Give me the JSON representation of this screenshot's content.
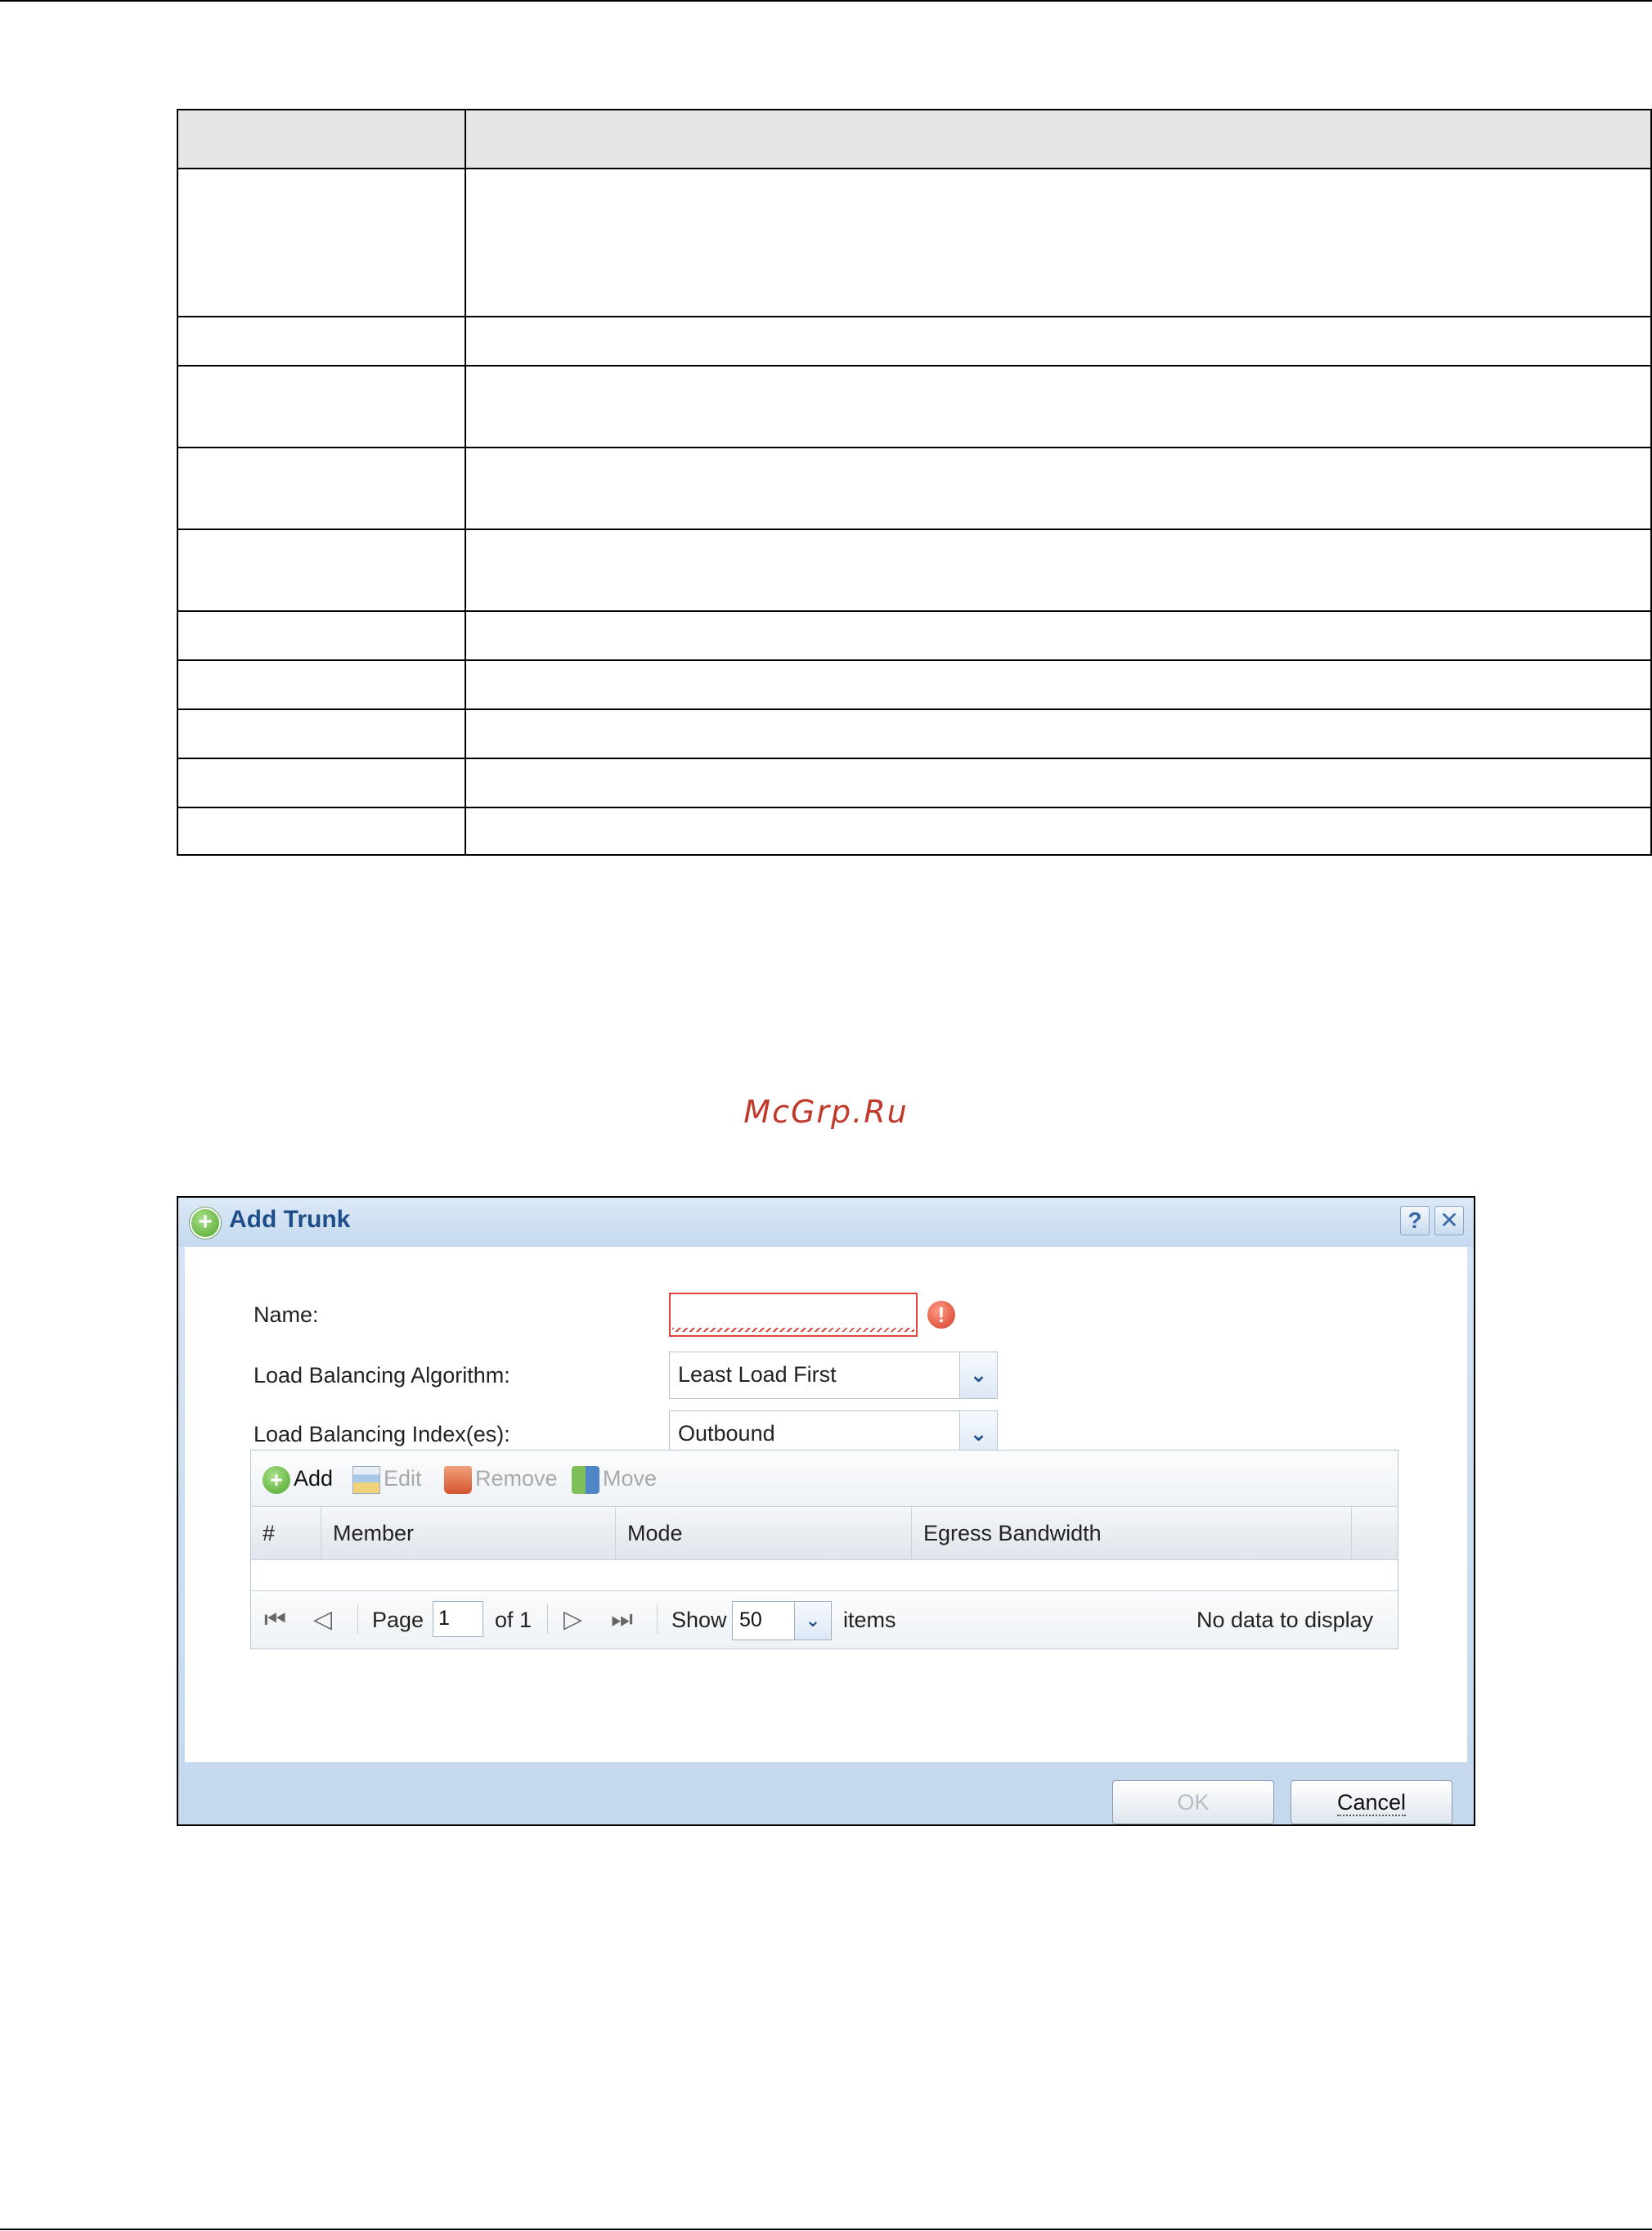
{
  "dialog": {
    "title": "Add Trunk",
    "help_glyph": "?",
    "close_glyph": "✕",
    "fields": {
      "name_label": "Name:",
      "name_value": "",
      "algorithm_label": "Load Balancing Algorithm:",
      "algorithm_value": "Least Load First",
      "index_label": "Load Balancing Index(es):",
      "index_value": "Outbound"
    },
    "toolbar": {
      "add": "Add",
      "edit": "Edit",
      "remove": "Remove",
      "move": "Move"
    },
    "columns": [
      "#",
      "Member",
      "Mode",
      "Egress Bandwidth"
    ],
    "pager": {
      "page_label": "Page",
      "page_value": "1",
      "of_label": "of 1",
      "show_label": "Show",
      "show_value": "50",
      "items_label": "items",
      "status": "No data to display"
    },
    "buttons": {
      "ok": "OK",
      "cancel": "Cancel"
    }
  },
  "watermark": "McGrp.Ru",
  "icons": {
    "title": "add-circle-icon",
    "warning": "warning-icon",
    "add": "add-circle-icon",
    "edit": "edit-icon",
    "remove": "trash-icon",
    "move": "move-icon"
  },
  "colors": {
    "title_text": "#1f4e8a",
    "error_border": "#e0433c",
    "watermark": "#c0392b",
    "disabled_text": "#a9a9a9"
  }
}
